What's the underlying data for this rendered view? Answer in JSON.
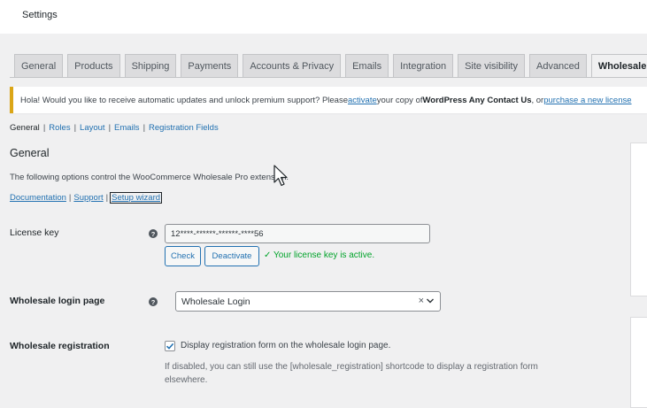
{
  "header": {
    "title": "Settings"
  },
  "tabs": [
    {
      "label": "General",
      "active": false
    },
    {
      "label": "Products",
      "active": false
    },
    {
      "label": "Shipping",
      "active": false
    },
    {
      "label": "Payments",
      "active": false
    },
    {
      "label": "Accounts & Privacy",
      "active": false
    },
    {
      "label": "Emails",
      "active": false
    },
    {
      "label": "Integration",
      "active": false
    },
    {
      "label": "Site visibility",
      "active": false
    },
    {
      "label": "Advanced",
      "active": false
    },
    {
      "label": "Wholesale",
      "active": true
    }
  ],
  "notice": {
    "text_before": "Hola! Would you like to receive automatic updates and unlock premium support? Please ",
    "activate_link": "activate",
    "text_middle": " your copy of ",
    "product_name": "WordPress Any Contact Us",
    "text_after": ", or ",
    "purchase_link": "purchase a new license"
  },
  "subnav": {
    "current": "General",
    "links": [
      "Roles",
      "Layout",
      "Emails",
      "Registration Fields"
    ],
    "separator": "|"
  },
  "section": {
    "title": "General",
    "description": "The following options control the WooCommerce Wholesale Pro extension.",
    "links": {
      "documentation": "Documentation",
      "support": "Support",
      "setup_wizard": "Setup wizard",
      "separator": "|"
    }
  },
  "license": {
    "label": "License key",
    "help": "?",
    "value": "12****-******-******-****56",
    "check_label": "Check",
    "deactivate_label": "Deactivate",
    "status": "✓ Your license key is active.",
    "status_color": "#00a32a"
  },
  "login_page": {
    "label": "Wholesale login page",
    "help": "?",
    "selected": "Wholesale Login",
    "clear": "×"
  },
  "registration": {
    "label": "Wholesale registration",
    "checked": true,
    "checkbox_label": "Display registration form on the wholesale login page.",
    "hint": "If disabled, you can still use the [wholesale_registration] shortcode to display a registration form elsewhere."
  },
  "colors": {
    "accent": "#2271b1",
    "notice_border": "#dba617"
  }
}
